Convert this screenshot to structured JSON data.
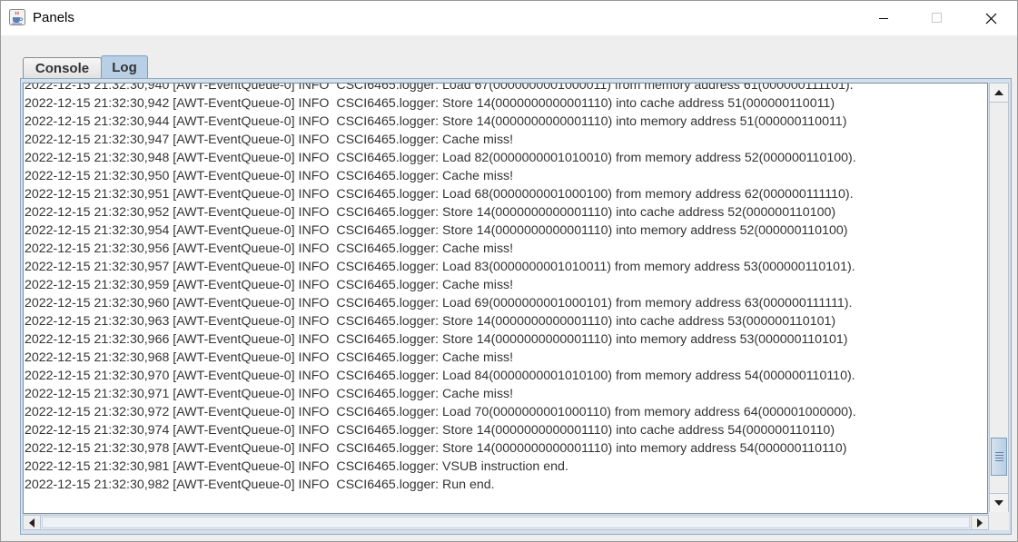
{
  "window": {
    "title": "Panels",
    "icon": "java-cup-icon"
  },
  "tabs": [
    {
      "label": "Console",
      "selected": false
    },
    {
      "label": "Log",
      "selected": true
    }
  ],
  "log": {
    "lines": [
      "2022-12-15 21:32:30,940 [AWT-EventQueue-0] INFO  CSCI6465.logger: Load 67(0000000001000011) from memory address 61(000000111101).",
      "2022-12-15 21:32:30,942 [AWT-EventQueue-0] INFO  CSCI6465.logger: Store 14(0000000000001110) into cache address 51(000000110011)",
      "2022-12-15 21:32:30,944 [AWT-EventQueue-0] INFO  CSCI6465.logger: Store 14(0000000000001110) into memory address 51(000000110011)",
      "2022-12-15 21:32:30,947 [AWT-EventQueue-0] INFO  CSCI6465.logger: Cache miss!",
      "2022-12-15 21:32:30,948 [AWT-EventQueue-0] INFO  CSCI6465.logger: Load 82(0000000001010010) from memory address 52(000000110100).",
      "2022-12-15 21:32:30,950 [AWT-EventQueue-0] INFO  CSCI6465.logger: Cache miss!",
      "2022-12-15 21:32:30,951 [AWT-EventQueue-0] INFO  CSCI6465.logger: Load 68(0000000001000100) from memory address 62(000000111110).",
      "2022-12-15 21:32:30,952 [AWT-EventQueue-0] INFO  CSCI6465.logger: Store 14(0000000000001110) into cache address 52(000000110100)",
      "2022-12-15 21:32:30,954 [AWT-EventQueue-0] INFO  CSCI6465.logger: Store 14(0000000000001110) into memory address 52(000000110100)",
      "2022-12-15 21:32:30,956 [AWT-EventQueue-0] INFO  CSCI6465.logger: Cache miss!",
      "2022-12-15 21:32:30,957 [AWT-EventQueue-0] INFO  CSCI6465.logger: Load 83(0000000001010011) from memory address 53(000000110101).",
      "2022-12-15 21:32:30,959 [AWT-EventQueue-0] INFO  CSCI6465.logger: Cache miss!",
      "2022-12-15 21:32:30,960 [AWT-EventQueue-0] INFO  CSCI6465.logger: Load 69(0000000001000101) from memory address 63(000000111111).",
      "2022-12-15 21:32:30,963 [AWT-EventQueue-0] INFO  CSCI6465.logger: Store 14(0000000000001110) into cache address 53(000000110101)",
      "2022-12-15 21:32:30,966 [AWT-EventQueue-0] INFO  CSCI6465.logger: Store 14(0000000000001110) into memory address 53(000000110101)",
      "2022-12-15 21:32:30,968 [AWT-EventQueue-0] INFO  CSCI6465.logger: Cache miss!",
      "2022-12-15 21:32:30,970 [AWT-EventQueue-0] INFO  CSCI6465.logger: Load 84(0000000001010100) from memory address 54(000000110110).",
      "2022-12-15 21:32:30,971 [AWT-EventQueue-0] INFO  CSCI6465.logger: Cache miss!",
      "2022-12-15 21:32:30,972 [AWT-EventQueue-0] INFO  CSCI6465.logger: Load 70(0000000001000110) from memory address 64(000001000000).",
      "2022-12-15 21:32:30,974 [AWT-EventQueue-0] INFO  CSCI6465.logger: Store 14(0000000000001110) into cache address 54(000000110110)",
      "2022-12-15 21:32:30,978 [AWT-EventQueue-0] INFO  CSCI6465.logger: Store 14(0000000000001110) into memory address 54(000000110110)",
      "2022-12-15 21:32:30,981 [AWT-EventQueue-0] INFO  CSCI6465.logger: VSUB instruction end.",
      "2022-12-15 21:32:30,982 [AWT-EventQueue-0] INFO  CSCI6465.logger: Run end."
    ]
  },
  "scrollbars": {
    "vertical_position": 0.95
  },
  "colors": {
    "selected_tab": "#b8cfe5",
    "scroll_thumb": "#b9cde2",
    "text": "#333333"
  }
}
